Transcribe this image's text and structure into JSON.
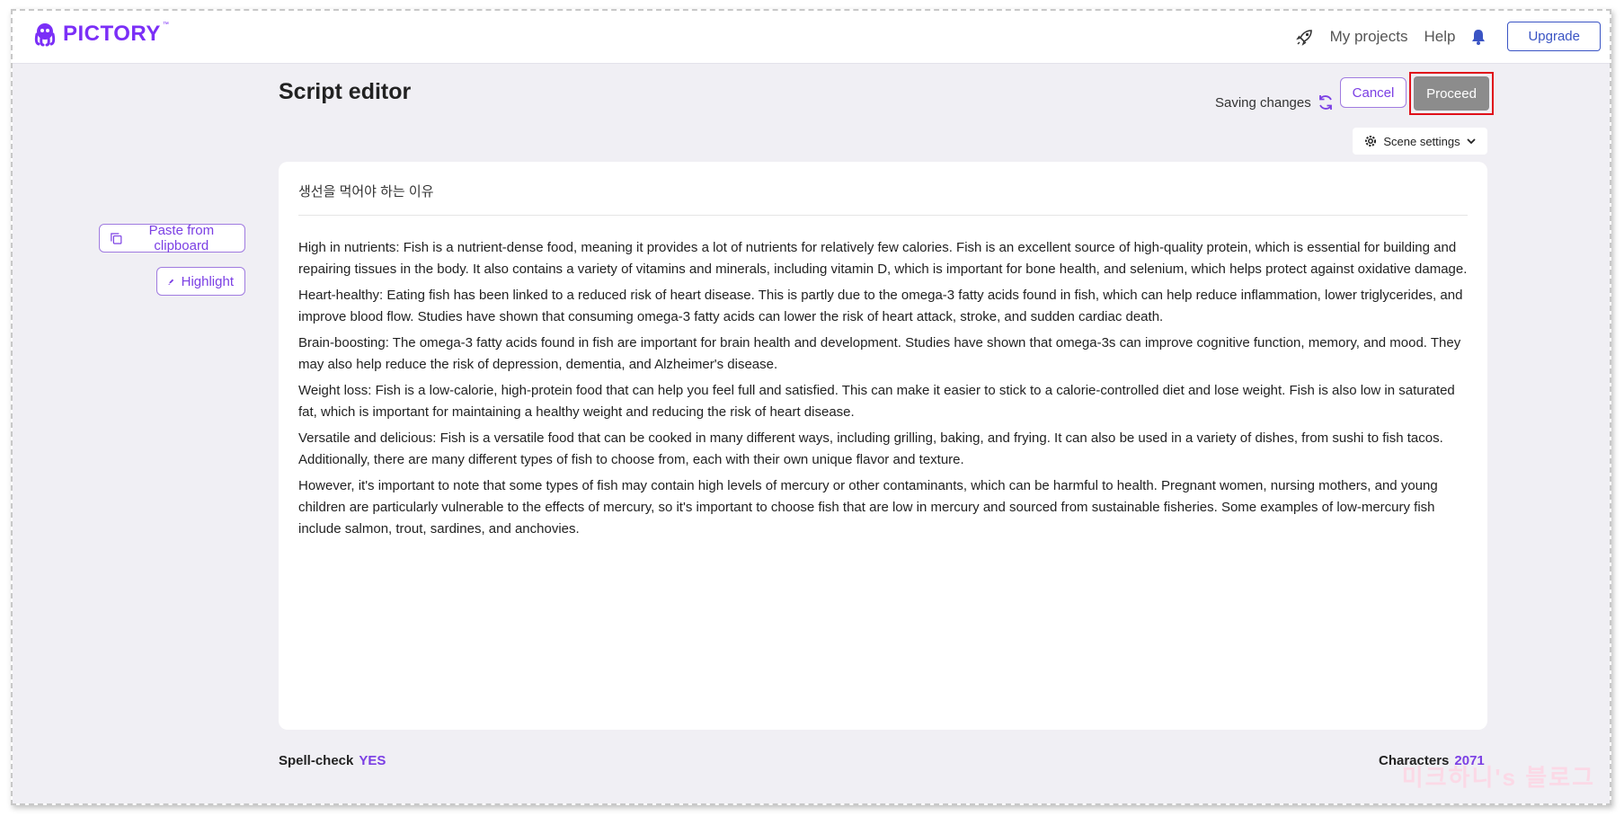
{
  "app": {
    "brand": "PICTORY",
    "tm": "™"
  },
  "nav": {
    "my_projects": "My projects",
    "help": "Help",
    "upgrade": "Upgrade"
  },
  "header": {
    "title": "Script editor",
    "saving": "Saving changes",
    "cancel": "Cancel",
    "proceed": "Proceed",
    "scene_settings": "Scene settings"
  },
  "side": {
    "paste": "Paste from clipboard",
    "highlight": "Highlight"
  },
  "editor": {
    "title": "생선을 먹어야 하는 이유",
    "paragraphs": [
      "High in nutrients: Fish is a nutrient-dense food, meaning it provides a lot of nutrients for relatively few calories. Fish is an excellent source of high-quality protein, which is essential for building and repairing tissues in the body. It also contains a variety of vitamins and minerals, including vitamin D, which is important for bone health, and selenium, which helps protect against oxidative damage.",
      "Heart-healthy: Eating fish has been linked to a reduced risk of heart disease. This is partly due to the omega-3 fatty acids found in fish, which can help reduce inflammation, lower triglycerides, and improve blood flow. Studies have shown that consuming omega-3 fatty acids can lower the risk of heart attack, stroke, and sudden cardiac death.",
      "Brain-boosting: The omega-3 fatty acids found in fish are important for brain health and development. Studies have shown that omega-3s can improve cognitive function, memory, and mood. They may also help reduce the risk of depression, dementia, and Alzheimer's disease.",
      "Weight loss: Fish is a low-calorie, high-protein food that can help you feel full and satisfied. This can make it easier to stick to a calorie-controlled diet and lose weight. Fish is also low in saturated fat, which is important for maintaining a healthy weight and reducing the risk of heart disease.",
      "Versatile and delicious: Fish is a versatile food that can be cooked in many different ways, including grilling, baking, and frying. It can also be used in a variety of dishes, from sushi to fish tacos. Additionally, there are many different types of fish to choose from, each with their own unique flavor and texture.",
      "However, it's important to note that some types of fish may contain high levels of mercury or other contaminants, which can be harmful to health. Pregnant women, nursing mothers, and young children are particularly vulnerable to the effects of mercury, so it's important to choose fish that are low in mercury and sourced from sustainable fisheries. Some examples of low-mercury fish include salmon, trout, sardines, and anchovies."
    ]
  },
  "footer": {
    "spell_label": "Spell-check",
    "spell_value": "YES",
    "chars_label": "Characters",
    "chars_value": "2071"
  },
  "watermark": "미크하니's 블로그",
  "colors": {
    "accent": "#7b3fe4",
    "highlight_box": "#e0101a",
    "upgrade": "#3a54c4"
  },
  "icons": [
    "octopus-logo-icon",
    "rocket-icon",
    "bell-icon",
    "sync-icon",
    "gear-icon",
    "chevron-down-icon",
    "copy-icon",
    "pen-icon"
  ]
}
